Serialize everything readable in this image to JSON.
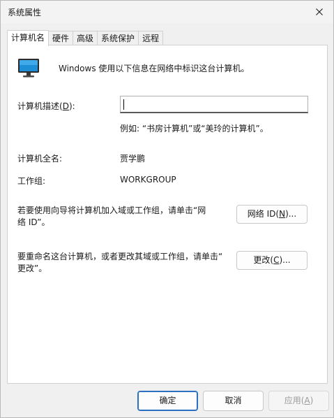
{
  "window": {
    "title": "系统属性"
  },
  "tabs": [
    {
      "label": "计算机名"
    },
    {
      "label": "硬件"
    },
    {
      "label": "高级"
    },
    {
      "label": "系统保护"
    },
    {
      "label": "远程"
    }
  ],
  "intro": "Windows 使用以下信息在网络中标识这台计算机。",
  "description": {
    "label_pre": "计算机描述(",
    "mnemonic": "D",
    "label_post": "):",
    "value": "",
    "hint": "例如: “书房计算机”或“美玲的计算机”。"
  },
  "fullname": {
    "label": "计算机全名:",
    "value": "贾学鹏"
  },
  "workgroup": {
    "label": "工作组:",
    "value": "WORKGROUP"
  },
  "network_id": {
    "text_line1": "若要使用向导将计算机加入域或工作组，请单击“网",
    "text_line2": "络 ID”。",
    "button_pre": "网络 ID(",
    "button_mnemonic": "N",
    "button_post": ")..."
  },
  "rename": {
    "text_line1": "要重命名这台计算机，或者更改其域或工作组，请单击“",
    "text_line2": "更改”。",
    "button_pre": "更改(",
    "button_mnemonic": "C",
    "button_post": ")..."
  },
  "footer": {
    "ok": "确定",
    "cancel": "取消",
    "apply_pre": "应用(",
    "apply_mnemonic": "A",
    "apply_post": ")"
  },
  "colors": {
    "accent": "#2b6fc0",
    "monitor_screen": "#1e8fd6"
  },
  "icons": {
    "close": "close-icon",
    "computer": "computer-monitor-icon"
  }
}
